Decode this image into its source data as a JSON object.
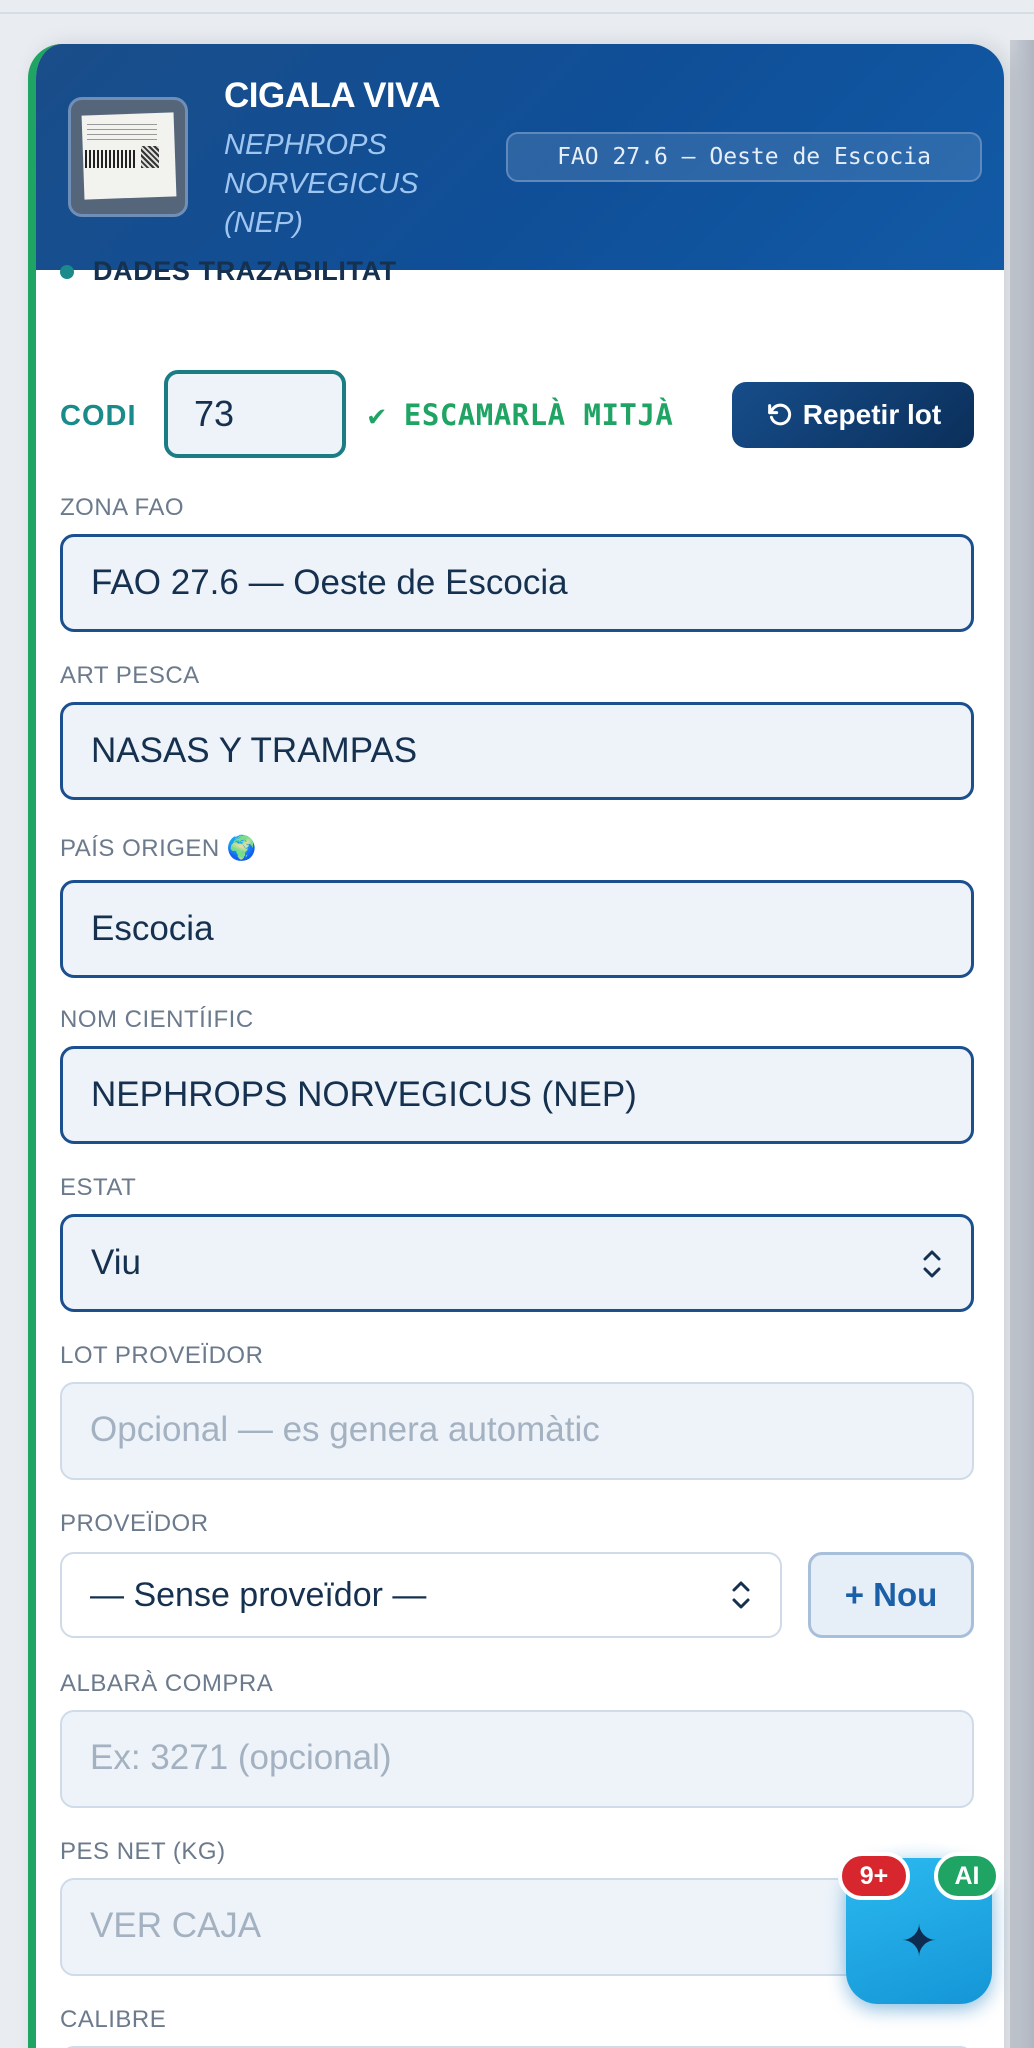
{
  "header": {
    "title": "CIGALA VIVA",
    "scientific_lines": [
      "NEPHROPS",
      "NORVEGICUS",
      "(NEP)"
    ],
    "fao_badge": "FAO 27.6 — Oeste de Escocia"
  },
  "section": {
    "title": "DADES TRAZABILITAT"
  },
  "codi": {
    "label": "CODI",
    "value": "73",
    "match_text": "✔ ESCAMARLÀ MITJÀ",
    "repeat_label": "Repetir lot"
  },
  "fields": {
    "zona_fao": {
      "label": "ZONA FAO",
      "value": "FAO 27.6 — Oeste de Escocia"
    },
    "art_pesca": {
      "label": "ART PESCA",
      "value": "NASAS Y TRAMPAS"
    },
    "pais_origen": {
      "label": "PAÍS ORIGEN 🌍",
      "value": "Escocia"
    },
    "nom_cientific": {
      "label": "NOM CIENTÍIFIC",
      "value": "NEPHROPS NORVEGICUS (NEP)"
    },
    "estat": {
      "label": "ESTAT",
      "value": "Viu"
    },
    "lot_proveidor": {
      "label": "LOT PROVEÏDOR",
      "placeholder": "Opcional — es genera automàtic"
    },
    "proveidor": {
      "label": "PROVEÏDOR",
      "value": "— Sense proveïdor —",
      "new_label": "+ Nou"
    },
    "albara": {
      "label": "ALBARÀ COMPRA",
      "placeholder": "Ex: 3271 (opcional)"
    },
    "pes_net": {
      "label": "PES NET (KG)",
      "placeholder": "VER CAJA"
    },
    "calibre": {
      "label": "CALIBRE"
    }
  },
  "fab": {
    "icon": "sparkle-icon",
    "count_badge": "9+",
    "ai_badge": "AI"
  },
  "colors": {
    "header_blue": "#0f4f98",
    "accent_green": "#1fa463",
    "teal": "#1a8a8a",
    "badge_red": "#d7262e"
  }
}
